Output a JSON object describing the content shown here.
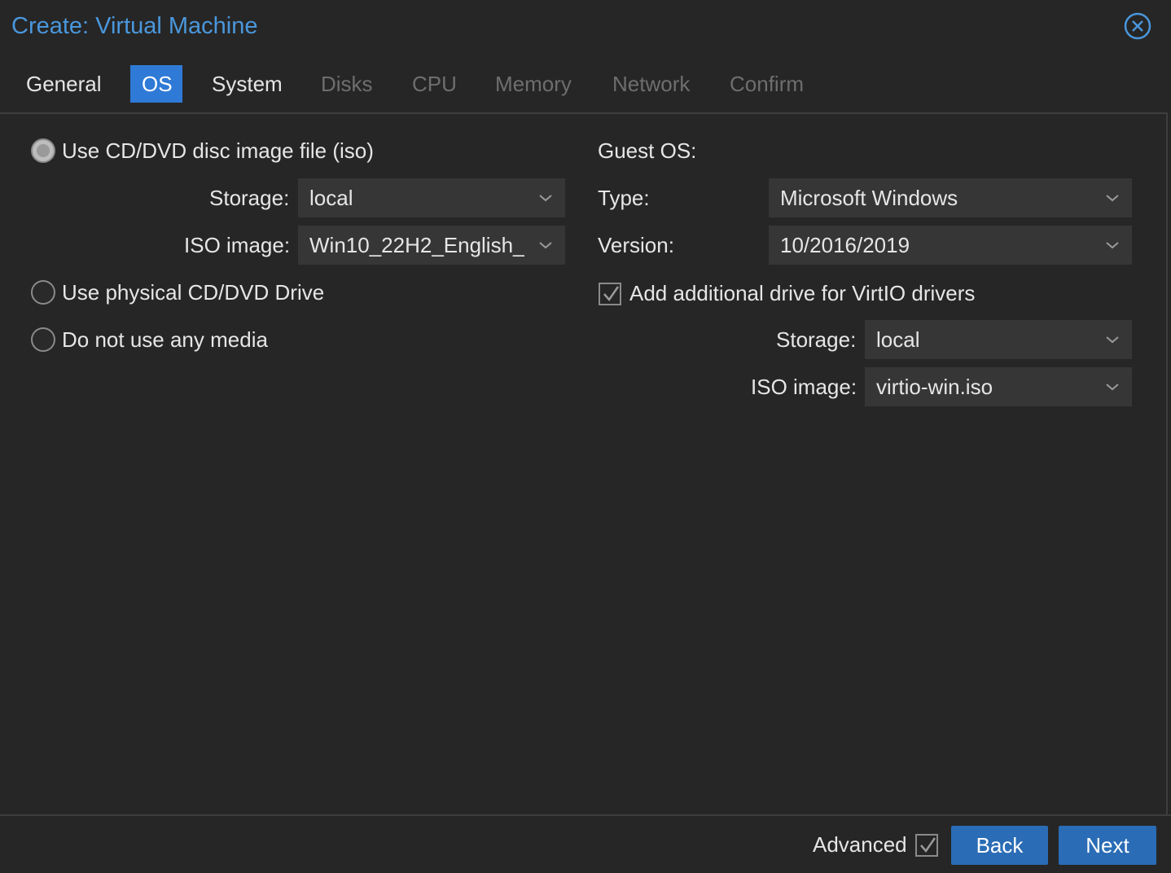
{
  "dialog": {
    "title": "Create: Virtual Machine"
  },
  "tabs": [
    {
      "label": "General",
      "state": "enabled"
    },
    {
      "label": "OS",
      "state": "active"
    },
    {
      "label": "System",
      "state": "enabled"
    },
    {
      "label": "Disks",
      "state": "disabled"
    },
    {
      "label": "CPU",
      "state": "disabled"
    },
    {
      "label": "Memory",
      "state": "disabled"
    },
    {
      "label": "Network",
      "state": "disabled"
    },
    {
      "label": "Confirm",
      "state": "disabled"
    }
  ],
  "media": {
    "options": [
      {
        "label": "Use CD/DVD disc image file (iso)",
        "checked": true
      },
      {
        "label": "Use physical CD/DVD Drive",
        "checked": false
      },
      {
        "label": "Do not use any media",
        "checked": false
      }
    ],
    "storage_label": "Storage:",
    "storage_value": "local",
    "iso_label": "ISO image:",
    "iso_value": "Win10_22H2_English_"
  },
  "guest_os": {
    "heading": "Guest OS:",
    "type_label": "Type:",
    "type_value": "Microsoft Windows",
    "version_label": "Version:",
    "version_value": "10/2016/2019",
    "virtio_checkbox_label": "Add additional drive for VirtIO drivers",
    "virtio_checked": true,
    "virtio_storage_label": "Storage:",
    "virtio_storage_value": "local",
    "virtio_iso_label": "ISO image:",
    "virtio_iso_value": "virtio-win.iso"
  },
  "footer": {
    "advanced_label": "Advanced",
    "advanced_checked": true,
    "back_label": "Back",
    "next_label": "Next"
  },
  "colors": {
    "accent": "#2f7ad6",
    "title": "#4a97dc",
    "background": "#262626",
    "field": "#363636",
    "button": "#2a6cb5",
    "disabled_text": "#6e6e6e"
  }
}
